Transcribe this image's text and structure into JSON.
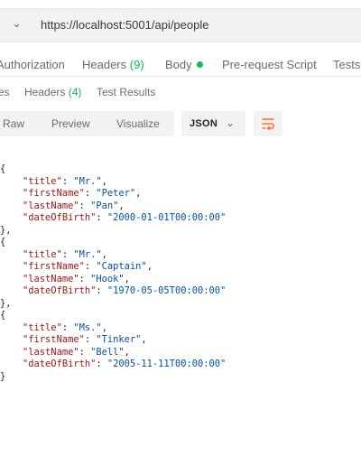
{
  "request": {
    "url": "https://localhost:5001/api/people",
    "tabs": [
      {
        "label": "Authorization"
      },
      {
        "label": "Headers",
        "count": "(9)"
      },
      {
        "label": "Body"
      },
      {
        "label": "Pre-request Script"
      },
      {
        "label": "Tests"
      }
    ]
  },
  "response": {
    "tabs": [
      {
        "label": "es"
      },
      {
        "label": "Headers",
        "count": "(4)"
      },
      {
        "label": "Test Results"
      }
    ],
    "view_modes": [
      "Raw",
      "Preview",
      "Visualize"
    ],
    "format": "JSON"
  },
  "colors": {
    "accent_green": "#0cbb52",
    "wrap_icon_orange": "#ff6c37",
    "json_key": "#a31515",
    "json_string": "#0451a5"
  },
  "body_people": [
    {
      "title": "Mr.",
      "firstName": "Peter",
      "lastName": "Pan",
      "dateOfBirth": "2000-01-01T00:00:00"
    },
    {
      "title": "Mr.",
      "firstName": "Captain",
      "lastName": "Hook",
      "dateOfBirth": "1970-05-05T00:00:00"
    },
    {
      "title": "Ms.",
      "firstName": "Tinker",
      "lastName": "Bell",
      "dateOfBirth": "2005-11-11T00:00:00"
    }
  ]
}
